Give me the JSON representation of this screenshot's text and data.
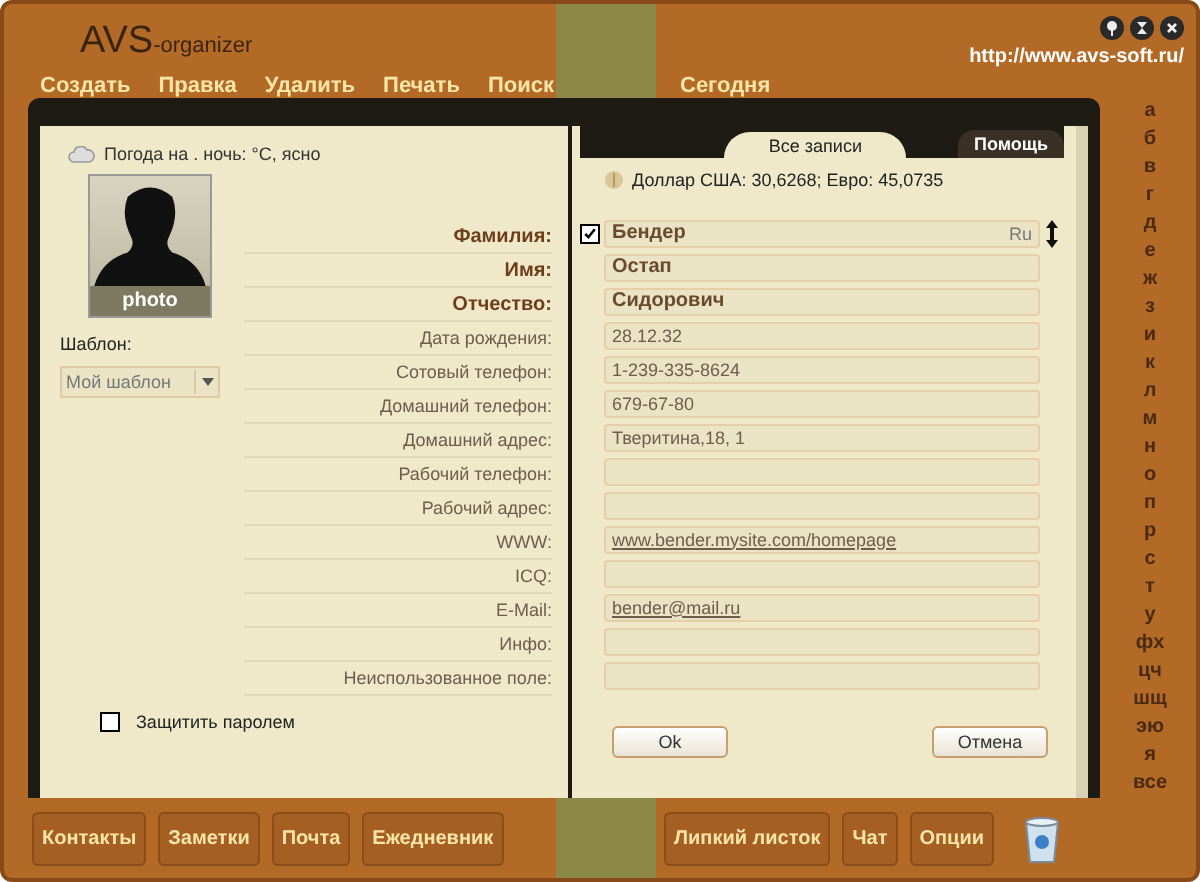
{
  "app": {
    "logo": "AVS",
    "logo_suffix": "-organizer",
    "url": "http://www.avs-soft.ru/"
  },
  "menu": [
    "Создать",
    "Правка",
    "Удалить",
    "Печать",
    "Поиск"
  ],
  "today": "Сегодня",
  "weather": "Погода на . ночь: °C, ясно",
  "photo_caption": "photo",
  "template": {
    "label": "Шаблон:",
    "value": "Мой шаблон"
  },
  "fields": [
    {
      "label": "Фамилия:",
      "value": "Бендер",
      "kind": "name"
    },
    {
      "label": "Имя:",
      "value": "Остап",
      "kind": "name"
    },
    {
      "label": "Отчество:",
      "value": "Сидорович",
      "kind": "name"
    },
    {
      "label": "Дата рождения:",
      "value": "28.12.32",
      "kind": "text"
    },
    {
      "label": "Сотовый телефон:",
      "value": "1-239-335-8624",
      "kind": "text"
    },
    {
      "label": "Домашний телефон:",
      "value": "679-67-80",
      "kind": "text"
    },
    {
      "label": "Домашний адрес:",
      "value": "Тверитина,18, 1",
      "kind": "text"
    },
    {
      "label": "Рабочий телефон:",
      "kind": "text"
    },
    {
      "label": "Рабочий адрес:",
      "kind": "text"
    },
    {
      "label": "WWW:",
      "value": "www.bender.mysite.com/homepage",
      "kind": "link"
    },
    {
      "label": "ICQ:",
      "kind": "text"
    },
    {
      "label": "E-Mail:",
      "value": "bender@mail.ru",
      "kind": "link"
    },
    {
      "label": "Инфо:",
      "kind": "text"
    },
    {
      "label": "Неиспользованное поле:",
      "kind": "text"
    }
  ],
  "password": {
    "label": "Защитить паролем",
    "checked": false
  },
  "right_tab": "Все записи",
  "help": "Помощь",
  "currency": "Доллар США: 30,6268; Евро: 45,0735",
  "record": {
    "checked": true,
    "lang": "Ru"
  },
  "buttons": [
    "Ok",
    "Отмена"
  ],
  "alphabet": [
    "а",
    "б",
    "в",
    "г",
    "д",
    "е",
    "ж",
    "з",
    "и",
    "к",
    "л",
    "м",
    "н",
    "о",
    "п",
    "р",
    "с",
    "т",
    "у",
    "фх",
    "цч",
    "шщ",
    "эю",
    "я",
    "все"
  ],
  "bottom_left": [
    "Контакты",
    "Заметки",
    "Почта",
    "Ежедневник"
  ],
  "bottom_right": [
    "Липкий листок",
    "Чат",
    "Опции"
  ]
}
